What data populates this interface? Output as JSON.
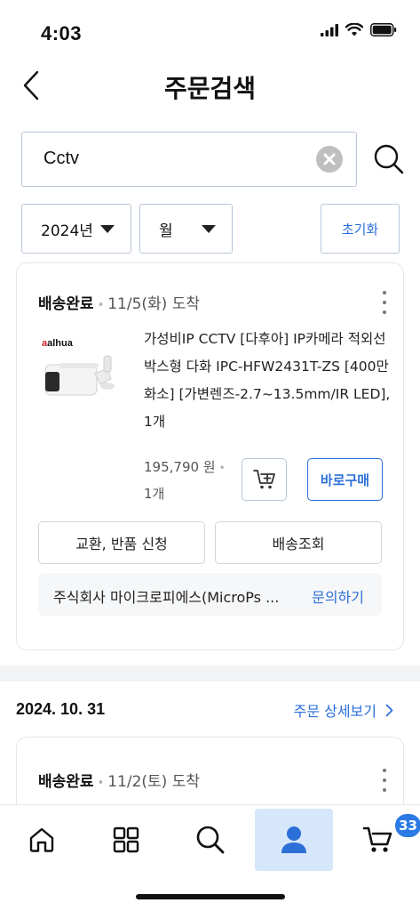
{
  "status_bar": {
    "time": "4:03"
  },
  "header": {
    "title": "주문검색"
  },
  "search": {
    "query": "Cctv"
  },
  "filters": {
    "year": "2024년",
    "month": "월",
    "reset_label": "초기화"
  },
  "orders": [
    {
      "delivery_status": "배송완료",
      "arrival": "11/5(화) 도착",
      "product": {
        "brand": "alhua",
        "title": "가성비IP CCTV [다후아] IP카메라 적외선 박스형 다화 IPC-HFW2431T-ZS [400만 화소] [가변렌즈-2.7~13.5mm/IR LED], 1개",
        "price": "195,790 원",
        "quantity": "1개"
      },
      "buy_now_label": "바로구매",
      "exchange_label": "교환, 반품 신청",
      "tracking_label": "배송조회",
      "seller": "주식회사 마이크로피에스(MicroPs ...",
      "inquiry_label": "문의하기"
    }
  ],
  "order_group": {
    "date": "2024. 10. 31",
    "detail_link": "주문 상세보기",
    "delivery_status": "배송완료",
    "arrival": "11/2(토) 도착"
  },
  "tab_bar": {
    "items": [
      "home-icon",
      "grid-icon",
      "search-icon",
      "person-icon",
      "cart-icon"
    ],
    "active": "person-icon",
    "cart_count": "33"
  },
  "colors": {
    "accent": "#2c6fd8",
    "active_tab_bg": "#d6e6fb",
    "badge": "#2c7be5"
  }
}
